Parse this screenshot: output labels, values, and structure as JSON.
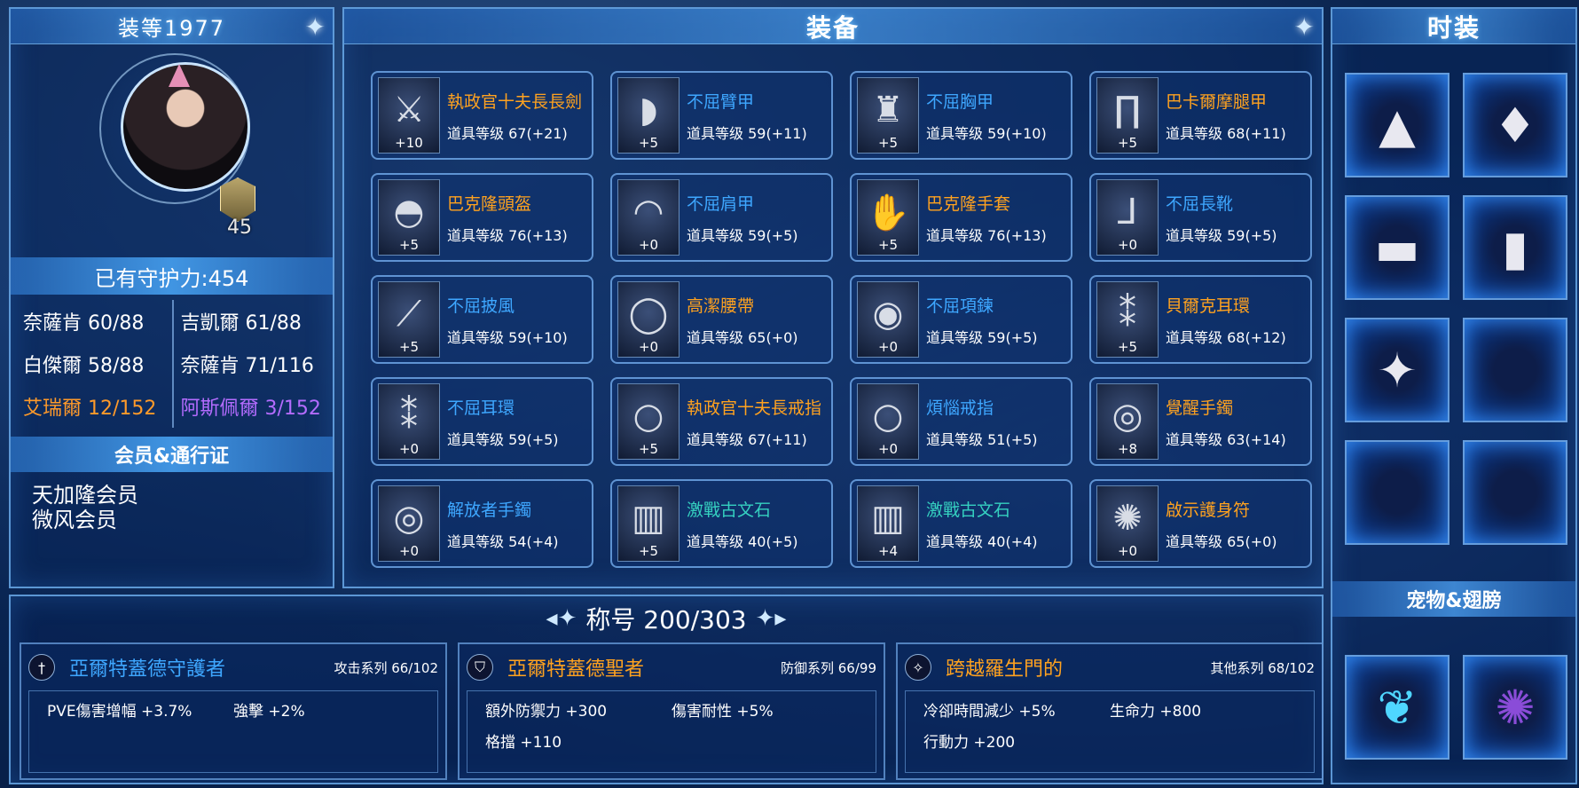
{
  "profile": {
    "gear_score": "装等1977",
    "level": "45",
    "guard_power": "已有守护力:454",
    "stats": [
      {
        "text": "奈薩肯 60/88",
        "color": "white"
      },
      {
        "text": "吉凱爾 61/88",
        "color": "white"
      },
      {
        "text": "白傑爾 58/88",
        "color": "white"
      },
      {
        "text": "奈薩肯 71/116",
        "color": "white"
      },
      {
        "text": "艾瑞爾 12/152",
        "color": "orange"
      },
      {
        "text": "阿斯佩爾 3/152",
        "color": "purple"
      }
    ],
    "membership_title": "会员&通行证",
    "memberships": [
      "天加隆会员",
      "微风会员"
    ]
  },
  "equipment": {
    "title": "装备",
    "items": [
      {
        "name": "執政官十夫長長劍",
        "level": "道具等级 67(+21)",
        "plus": "+10",
        "color": "orange",
        "icon": "sword-icon"
      },
      {
        "name": "不屈臂甲",
        "level": "道具等级 59(+11)",
        "plus": "+5",
        "color": "blue",
        "icon": "bracer-icon"
      },
      {
        "name": "不屈胸甲",
        "level": "道具等级 59(+10)",
        "plus": "+5",
        "color": "blue",
        "icon": "chest-armor-icon"
      },
      {
        "name": "巴卡爾摩腿甲",
        "level": "道具等级 68(+11)",
        "plus": "+5",
        "color": "orange",
        "icon": "leg-armor-icon"
      },
      {
        "name": "巴克隆頭盔",
        "level": "道具等级 76(+13)",
        "plus": "+5",
        "color": "orange",
        "icon": "helmet-icon"
      },
      {
        "name": "不屈肩甲",
        "level": "道具等级 59(+5)",
        "plus": "+0",
        "color": "blue",
        "icon": "shoulder-icon"
      },
      {
        "name": "巴克隆手套",
        "level": "道具等级 76(+13)",
        "plus": "+5",
        "color": "orange",
        "icon": "glove-icon"
      },
      {
        "name": "不屈長靴",
        "level": "道具等级 59(+5)",
        "plus": "+0",
        "color": "blue",
        "icon": "boot-icon"
      },
      {
        "name": "不屈披風",
        "level": "道具等级 59(+10)",
        "plus": "+5",
        "color": "blue",
        "icon": "cape-icon"
      },
      {
        "name": "高潔腰帶",
        "level": "道具等级 65(+0)",
        "plus": "+0",
        "color": "orange",
        "icon": "belt-icon"
      },
      {
        "name": "不屈項鍊",
        "level": "道具等级 59(+5)",
        "plus": "+0",
        "color": "blue",
        "icon": "necklace-icon"
      },
      {
        "name": "貝爾克耳環",
        "level": "道具等级 68(+12)",
        "plus": "+5",
        "color": "orange",
        "icon": "earring-icon"
      },
      {
        "name": "不屈耳環",
        "level": "道具等级 59(+5)",
        "plus": "+0",
        "color": "blue",
        "icon": "earring-icon"
      },
      {
        "name": "執政官十夫長戒指",
        "level": "道具等级 67(+11)",
        "plus": "+5",
        "color": "orange",
        "icon": "ring-icon"
      },
      {
        "name": "煩惱戒指",
        "level": "道具等级 51(+5)",
        "plus": "+0",
        "color": "blue",
        "icon": "ring-icon"
      },
      {
        "name": "覺醒手鐲",
        "level": "道具等级 63(+14)",
        "plus": "+8",
        "color": "orange",
        "icon": "bracelet-icon"
      },
      {
        "name": "解放者手鐲",
        "level": "道具等级 54(+4)",
        "plus": "+0",
        "color": "blue",
        "icon": "bracelet-icon"
      },
      {
        "name": "激戰古文石",
        "level": "道具等级 40(+5)",
        "plus": "+5",
        "color": "teal",
        "icon": "rune-stone-icon"
      },
      {
        "name": "激戰古文石",
        "level": "道具等级 40(+4)",
        "plus": "+4",
        "color": "teal",
        "icon": "rune-stone-icon"
      },
      {
        "name": "啟示護身符",
        "level": "道具等级 65(+0)",
        "plus": "+0",
        "color": "orange",
        "icon": "amulet-icon"
      }
    ]
  },
  "fashion": {
    "title": "时装",
    "slots": [
      {
        "icon": "party-hat-icon",
        "glyph": "▲"
      },
      {
        "icon": "jacket-icon",
        "glyph": "♦"
      },
      {
        "icon": "shorts-icon",
        "glyph": "▬"
      },
      {
        "icon": "boots-icon",
        "glyph": "▮"
      },
      {
        "icon": "weapon-skin-icon",
        "glyph": "✦"
      },
      {
        "icon": "empty-slot",
        "glyph": ""
      },
      {
        "icon": "empty-slot",
        "glyph": ""
      },
      {
        "icon": "empty-slot",
        "glyph": ""
      }
    ],
    "pet_title": "宠物&翅膀",
    "pets": [
      {
        "icon": "butterfly-wings-icon",
        "glyph": "❦"
      },
      {
        "icon": "purple-pet-icon",
        "glyph": "✺"
      }
    ]
  },
  "titles": {
    "heading": "称号 200/303",
    "cards": [
      {
        "name": "亞爾特蓋德守護者",
        "color": "blue",
        "category": "攻击系列 66/102",
        "icon": "sword-emblem-icon",
        "effects": [
          "PVE傷害增幅 +3.7%",
          "強擊 +2%"
        ]
      },
      {
        "name": "亞爾特蓋德聖者",
        "color": "orange",
        "category": "防御系列 66/99",
        "icon": "shield-emblem-icon",
        "effects": [
          "額外防禦力 +300",
          "傷害耐性 +5%",
          "格擋 +110"
        ]
      },
      {
        "name": "跨越羅生門的",
        "color": "orange",
        "category": "其他系列 68/102",
        "icon": "star-emblem-icon",
        "effects": [
          "冷卻時間減少 +5%",
          "生命力 +800",
          "行動力 +200"
        ]
      }
    ]
  },
  "colors": {
    "orange": "#ffa21f",
    "blue": "#3ea7ff",
    "teal": "#35d0c0",
    "purple": "#b46cff",
    "border": "#78beff"
  }
}
